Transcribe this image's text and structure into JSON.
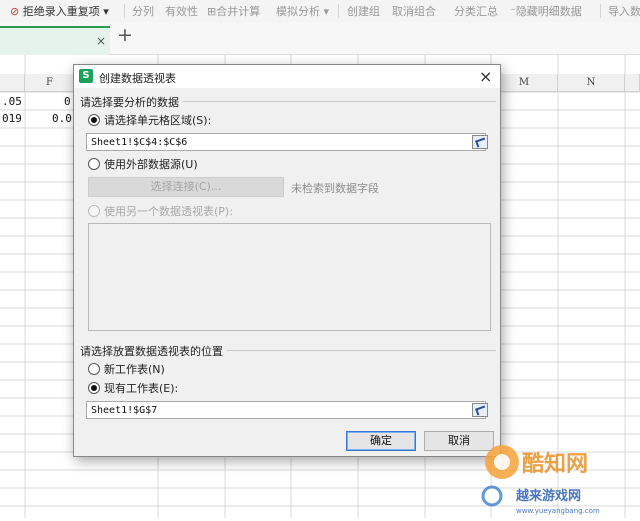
{
  "toolbar": {
    "reject_duplicates": "拒绝录入重复项",
    "split": "分列",
    "validity": "有效性",
    "merge_calc": "合并计算",
    "simulate": "模拟分析",
    "create_group": "创建组",
    "ungroup": "取消组合",
    "subtotal": "分类汇总",
    "hide_detail": "隐藏明细数据",
    "import": "导入数"
  },
  "tab_bar": {
    "close": "×",
    "add": "+"
  },
  "columns": [
    "F",
    "M",
    "N"
  ],
  "cells": {
    "r1_e": ".05",
    "r1_f": "0",
    "r2_e": "019",
    "r2_f": "0.0"
  },
  "dialog": {
    "title": "创建数据透视表",
    "logo_letter": "S",
    "close": "×",
    "section_source": "请选择要分析的数据",
    "radio_range": "请选择单元格区域(S):",
    "range_value": "Sheet1!$C$4:$C$6",
    "radio_external": "使用外部数据源(U)",
    "select_connection": "选择连接(C)...",
    "no_fields_hint": "未检索到数据字段",
    "radio_other_pivot": "使用另一个数据透视表(P):",
    "section_location": "请选择放置数据透视表的位置",
    "radio_new_sheet": "新工作表(N)",
    "radio_existing_sheet": "现有工作表(E):",
    "location_value": "Sheet1!$G$7",
    "ok": "确定",
    "cancel": "取消",
    "selected_source": "请选择单元格区域",
    "selected_location": "现有工作表"
  },
  "watermark": {
    "brand": "酷知网",
    "site": "越来游戏网",
    "url": "www.yueyangbang.com"
  },
  "colors": {
    "accent_green": "#2e9d4f",
    "logo_green": "#1aa15a",
    "ok_border": "#3a77d3"
  }
}
